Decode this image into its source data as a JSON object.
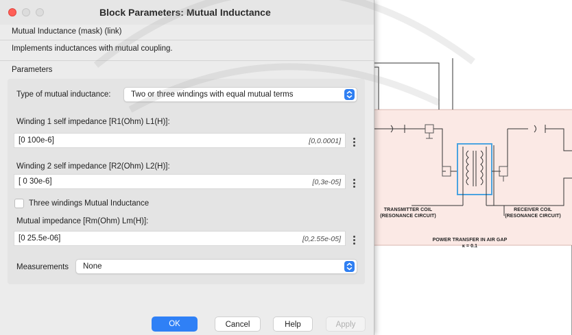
{
  "window": {
    "title": "Block Parameters: Mutual Inductance"
  },
  "header": {
    "mask_title": "Mutual Inductance (mask) (link)",
    "description": "Implements inductances with mutual coupling."
  },
  "parameters": {
    "section_label": "Parameters",
    "type_label": "Type of mutual inductance:",
    "type_value": "Two or three windings with equal mutual terms",
    "winding1_label": "Winding 1 self impedance [R1(Ohm) L1(H)]:",
    "winding1_value": "[0 100e-6]",
    "winding1_eval": "[0,0.0001]",
    "winding2_label": "Winding 2 self impedance [R2(Ohm) L2(H)]:",
    "winding2_value": "[ 0 30e-6]",
    "winding2_eval": "[0,3e-05]",
    "three_windings_label": "Three windings Mutual Inductance",
    "three_windings_checked": false,
    "mutual_label": "Mutual impedance [Rm(Ohm) Lm(H)]:",
    "mutual_value": "[0 25.5e-06]",
    "mutual_eval": "[0,2.55e-05]",
    "measurements_label": "Measurements",
    "measurements_value": "None"
  },
  "buttons": {
    "ok": "OK",
    "cancel": "Cancel",
    "help": "Help",
    "apply": "Apply"
  },
  "diagram": {
    "transmitter_line1": "TRANSMITTER COIL",
    "transmitter_line2": "(RESONANCE CIRCUIT)",
    "receiver_line1": "RECEIVER COIL",
    "receiver_line2": "(RESONANCE CIRCUIT)",
    "gap_line1": "POWER TRANSFER IN AIR GAP",
    "gap_line2": "κ = 0.1"
  },
  "colors": {
    "accent": "#2f80f6",
    "close": "#ff5f57",
    "diagram_area": "#fbe9e5",
    "coil_box": "#4aa3e0"
  }
}
